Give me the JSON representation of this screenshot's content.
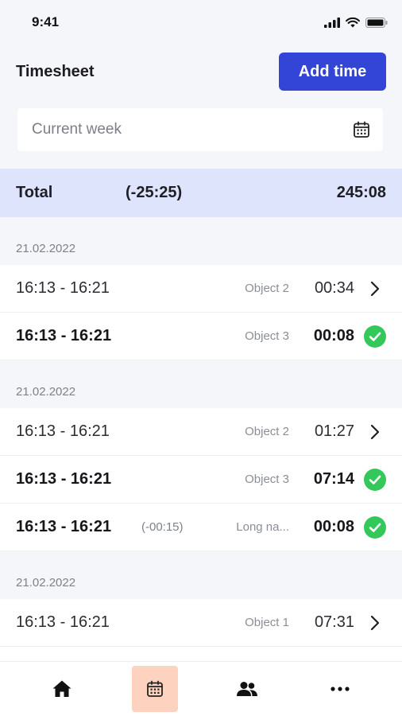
{
  "status_bar": {
    "time": "9:41"
  },
  "header": {
    "title": "Timesheet",
    "add_button": "Add time"
  },
  "filter": {
    "value": "Current week"
  },
  "total": {
    "label": "Total",
    "difference": "(-25:25)",
    "value": "245:08"
  },
  "groups": [
    {
      "date": "21.02.2022",
      "entries": [
        {
          "time": "16:13 - 16:21",
          "diff": "",
          "object": "Object 2",
          "duration": "00:34",
          "status": "chevron",
          "bold": false
        },
        {
          "time": "16:13 - 16:21",
          "diff": "",
          "object": "Object 3",
          "duration": "00:08",
          "status": "check",
          "bold": true
        }
      ]
    },
    {
      "date": "21.02.2022",
      "entries": [
        {
          "time": "16:13 - 16:21",
          "diff": "",
          "object": "Object 2",
          "duration": "01:27",
          "status": "chevron",
          "bold": false
        },
        {
          "time": "16:13 - 16:21",
          "diff": "",
          "object": "Object 3",
          "duration": "07:14",
          "status": "check",
          "bold": true
        },
        {
          "time": "16:13 - 16:21",
          "diff": "(-00:15)",
          "object": "Long na...",
          "duration": "00:08",
          "status": "check",
          "bold": true
        }
      ]
    },
    {
      "date": "21.02.2022",
      "entries": [
        {
          "time": "16:13 - 16:21",
          "diff": "",
          "object": "Object 1",
          "duration": "07:31",
          "status": "chevron",
          "bold": false
        }
      ]
    }
  ],
  "bottom_nav": [
    {
      "icon": "home-icon",
      "active": false
    },
    {
      "icon": "calendar-icon",
      "active": true
    },
    {
      "icon": "people-icon",
      "active": false
    },
    {
      "icon": "more-icon",
      "active": false
    }
  ],
  "colors": {
    "accent": "#3345d6",
    "success": "#34c759",
    "total_bg": "#dde4fb",
    "active_nav": "#fdd3bf"
  }
}
